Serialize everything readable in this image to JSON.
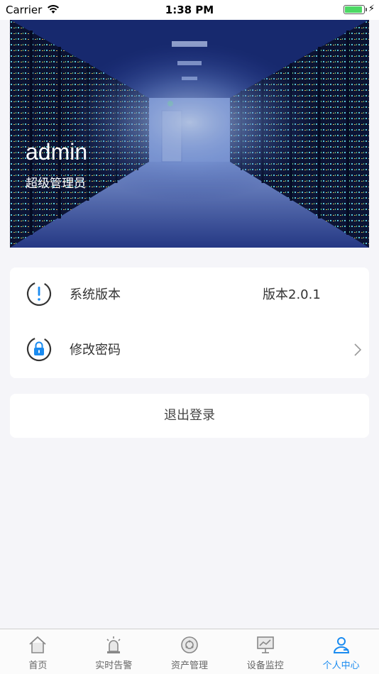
{
  "status_bar": {
    "carrier": "Carrier",
    "time": "1:38 PM",
    "battery_level": 1.0
  },
  "profile": {
    "username": "admin",
    "role": "超级管理员"
  },
  "settings": {
    "version_label": "系统版本",
    "version_value": "版本2.0.1",
    "change_password_label": "修改密码"
  },
  "logout_label": "退出登录",
  "tabs": [
    {
      "label": "首页",
      "icon": "home-icon",
      "active": false
    },
    {
      "label": "实时告警",
      "icon": "alarm-icon",
      "active": false
    },
    {
      "label": "资产管理",
      "icon": "asset-icon",
      "active": false
    },
    {
      "label": "设备监控",
      "icon": "monitor-icon",
      "active": false
    },
    {
      "label": "个人中心",
      "icon": "user-icon",
      "active": true
    }
  ],
  "colors": {
    "accent": "#1a8bf0",
    "background": "#f5f5f9",
    "card": "#ffffff",
    "text": "#333333"
  }
}
